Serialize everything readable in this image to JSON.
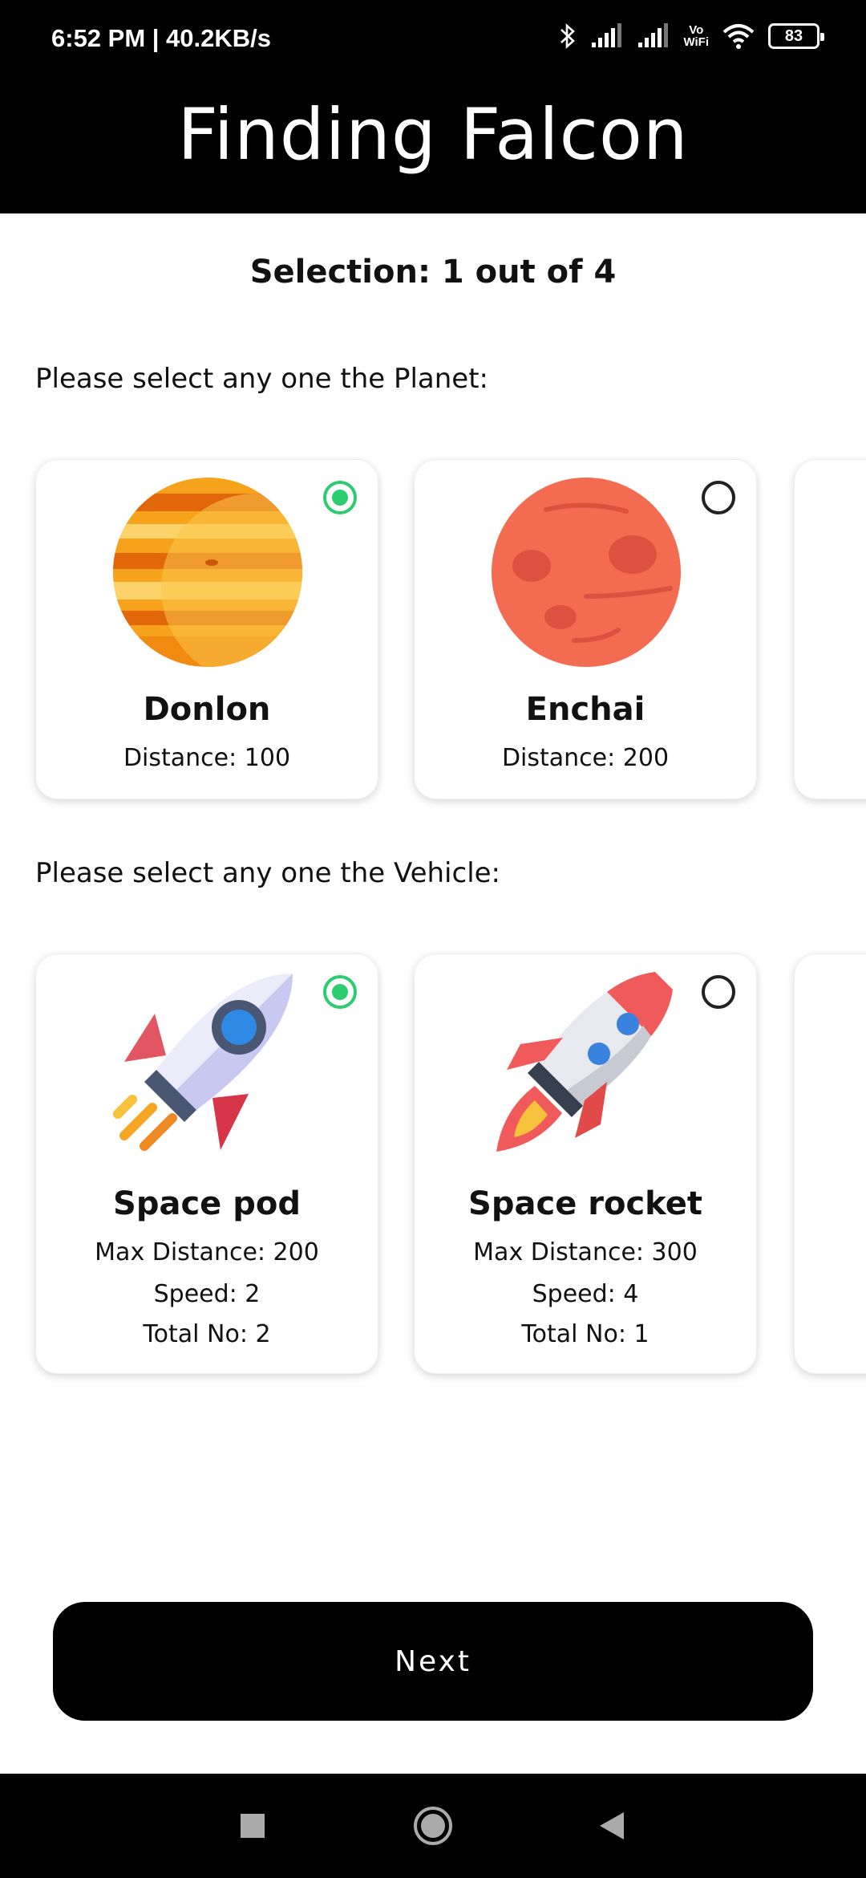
{
  "status_bar": {
    "time": "6:52 PM | 40.2KB/s",
    "vowifi_top": "Vo",
    "vowifi_bottom": "WiFi",
    "battery": "83"
  },
  "app_bar": {
    "title": "Finding Falcon"
  },
  "selection": {
    "title": "Selection: 1 out of 4"
  },
  "planet_section": {
    "label": "Please select any one the Planet:",
    "cards": [
      {
        "name": "Donlon",
        "distance": "Distance: 100",
        "selected": true,
        "icon": "planet-jupiter-icon"
      },
      {
        "name": "Enchai",
        "distance": "Distance: 200",
        "selected": false,
        "icon": "planet-mars-icon"
      }
    ]
  },
  "vehicle_section": {
    "label": "Please select any one the Vehicle:",
    "cards": [
      {
        "name": "Space pod",
        "max_distance": "Max Distance: 200",
        "speed": "Speed: 2",
        "total": "Total No: 2",
        "selected": true,
        "icon": "space-pod-icon"
      },
      {
        "name": "Space rocket",
        "max_distance": "Max Distance: 300",
        "speed": "Speed: 4",
        "total": "Total No: 1",
        "selected": false,
        "icon": "space-rocket-icon"
      }
    ]
  },
  "actions": {
    "next_label": "Next"
  },
  "colors": {
    "selected_radio": "#2ecc71",
    "header_bg": "#000000",
    "button_bg": "#000000"
  }
}
